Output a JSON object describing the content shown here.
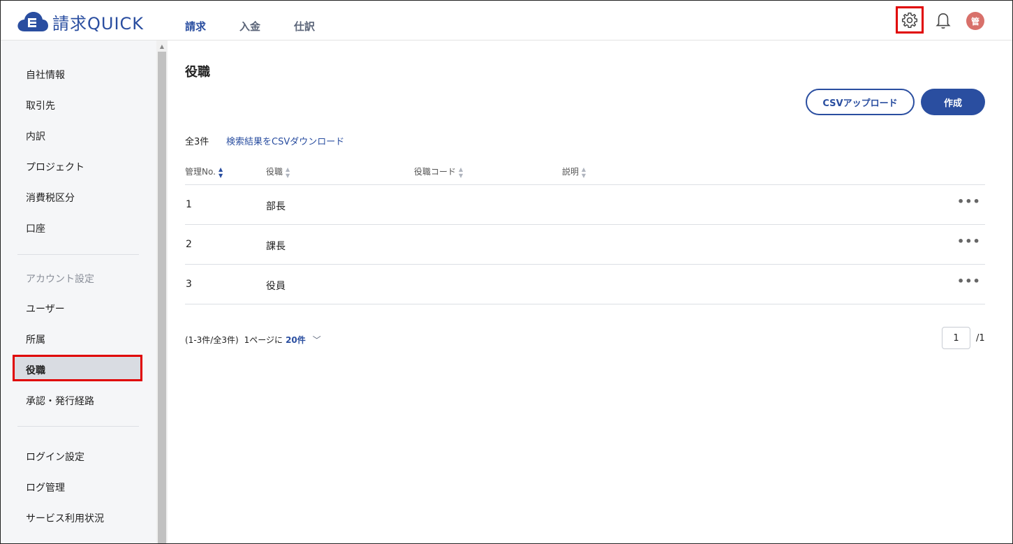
{
  "app": {
    "logo_text": "請求QUICK",
    "brand_color": "#2a4ea0",
    "highlight_color": "#e00000"
  },
  "header": {
    "nav": [
      "請求",
      "入金",
      "仕訳"
    ],
    "active_nav": "請求",
    "icons": [
      "gear-icon",
      "bell-icon"
    ],
    "avatar_label": "管"
  },
  "sidebar": {
    "items_top": [
      "自社情報",
      "取引先",
      "内訳",
      "プロジェクト",
      "消費税区分",
      "口座"
    ],
    "section_label": "アカウント設定",
    "items_account": [
      "ユーザー",
      "所属",
      "役職",
      "承認・発行経路"
    ],
    "active_item": "役職",
    "items_bottom": [
      "ログイン設定",
      "ログ管理",
      "サービス利用状況"
    ]
  },
  "main": {
    "title": "役職",
    "csv_upload_label": "CSVアップロード",
    "create_label": "作成",
    "count_label": "全3件",
    "download_link": "検索結果をCSVダウンロード",
    "columns": [
      "管理No.",
      "役職",
      "役職コード",
      "説明"
    ],
    "rows": [
      {
        "no": "1",
        "title": "部長",
        "code": "",
        "description": ""
      },
      {
        "no": "2",
        "title": "課長",
        "code": "",
        "description": ""
      },
      {
        "no": "3",
        "title": "役員",
        "code": "",
        "description": ""
      }
    ],
    "more_label": "•••",
    "pager": {
      "range": "(1-3件/全3件)",
      "per_page_prefix": "1ページに",
      "per_page_value": "20件",
      "current_page": "1",
      "total_pages": "/1"
    }
  }
}
